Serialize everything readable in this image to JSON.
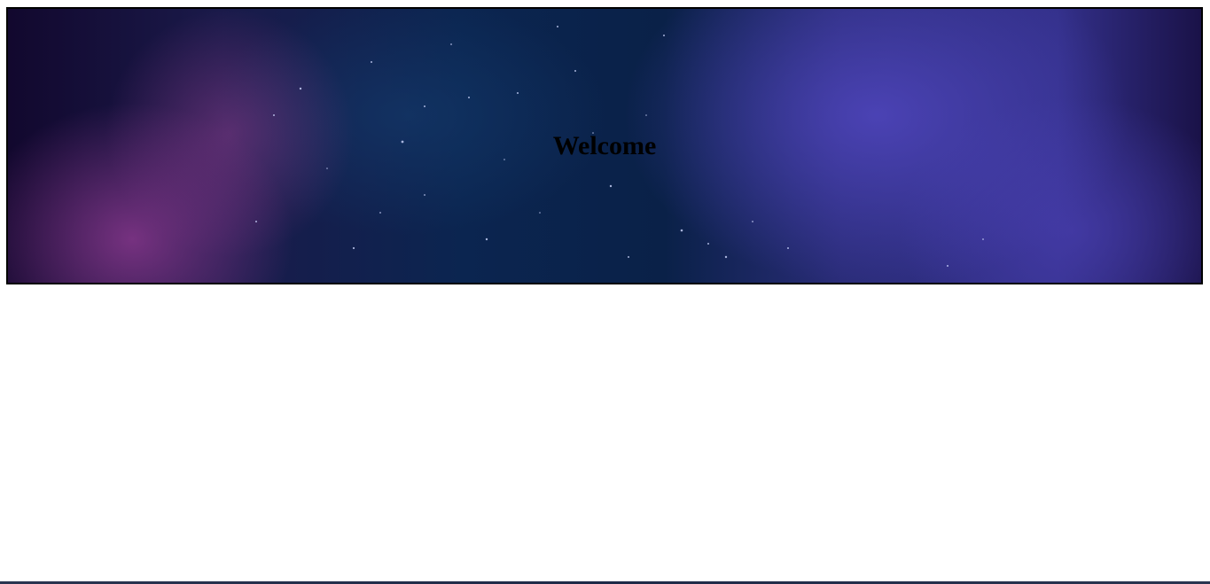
{
  "hero": {
    "title": "Welcome",
    "colors": {
      "deep_navy": "#0a2148",
      "magenta_nebula": "#963c96",
      "violet_nebula": "#5046be",
      "border": "#000000"
    }
  }
}
